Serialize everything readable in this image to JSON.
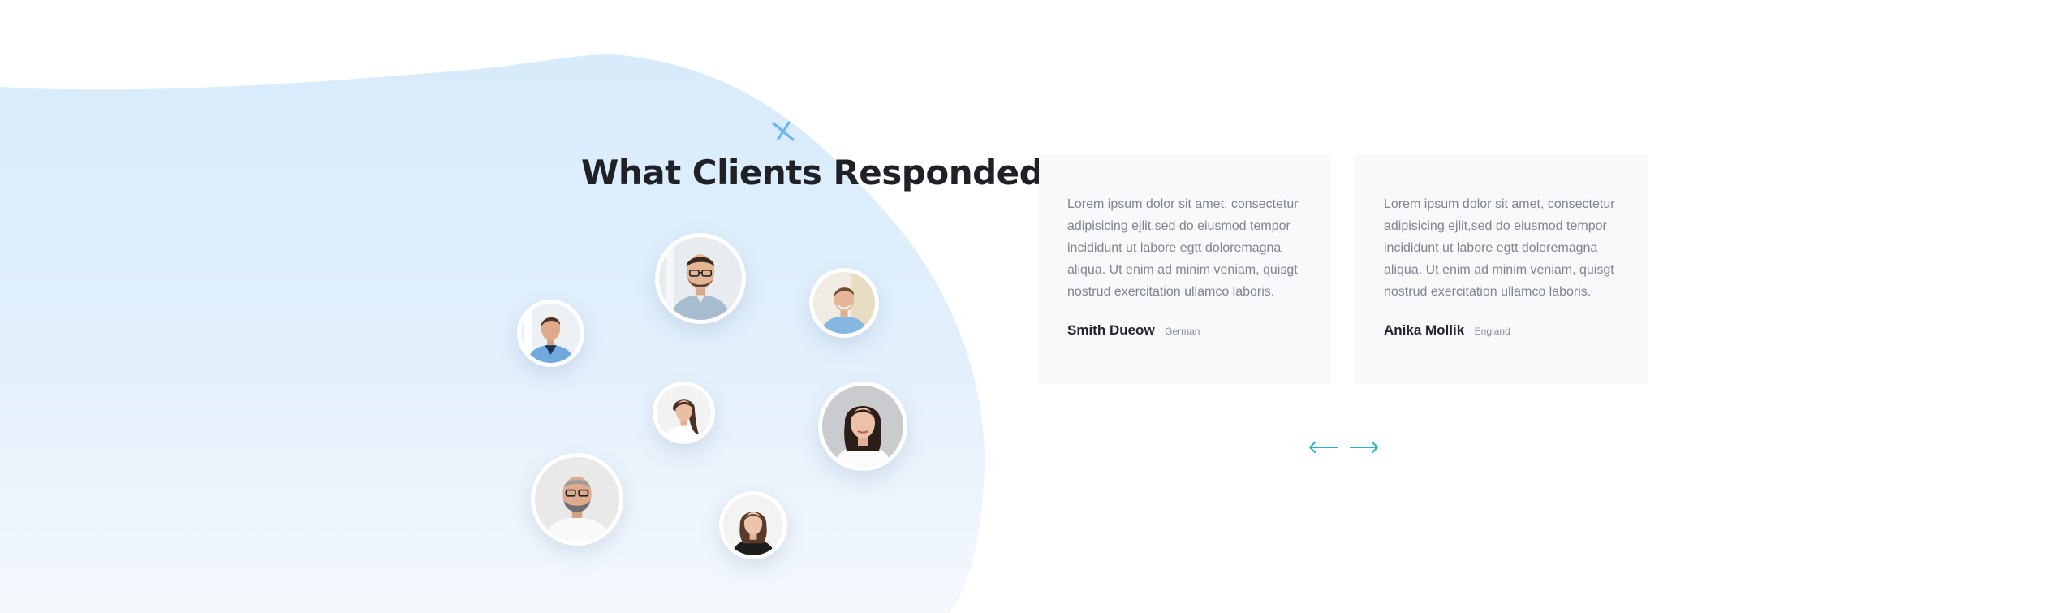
{
  "section": {
    "heading": "What Clients Responded"
  },
  "testimonials": [
    {
      "quote": "Lorem ipsum dolor sit amet, consectetur adipisicing ejlit,sed do eiusmod tempor incididunt ut labore egtt doloremagna aliqua. Ut enim ad minim veniam, quisgt nostrud exercitation ullamco laboris.",
      "name": "Smith Dueow",
      "country": "German"
    },
    {
      "quote": "Lorem ipsum dolor sit amet, consectetur adipisicing ejlit,sed do eiusmod tempor incididunt ut labore egtt doloremagna aliqua. Ut enim ad minim veniam, quisgt nostrud exercitation ullamco laboris.",
      "name": "Anika Mollik",
      "country": "England"
    }
  ],
  "navigation": {
    "prev_icon": "arrow-left-icon",
    "next_icon": "arrow-right-icon"
  },
  "colors": {
    "accent": "#1fb8c4",
    "blob": "#daecfb",
    "heading": "#1f2127",
    "card_bg": "#f8f9fb",
    "body_text": "#80848c"
  }
}
